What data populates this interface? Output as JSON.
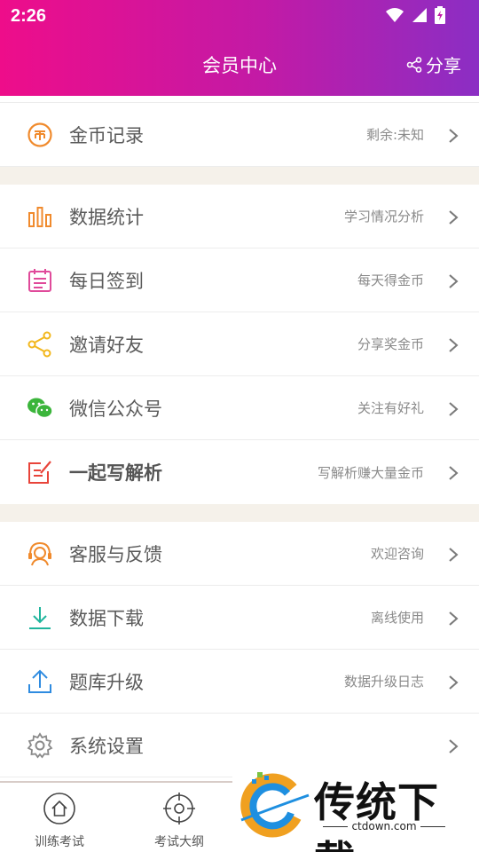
{
  "status_bar": {
    "time": "2:26"
  },
  "header": {
    "title": "会员中心",
    "share_label": "分享"
  },
  "groups": [
    {
      "items": [
        {
          "label": "金币记录",
          "sub": "剩余:未知",
          "icon": "coin-icon",
          "color": "#f08a2c"
        }
      ]
    },
    {
      "items": [
        {
          "label": "数据统计",
          "sub": "学习情况分析",
          "icon": "bar-chart-icon",
          "color": "#f08a2c"
        },
        {
          "label": "每日签到",
          "sub": "每天得金币",
          "icon": "calendar-icon",
          "color": "#e04a9a"
        },
        {
          "label": "邀请好友",
          "sub": "分享奖金币",
          "icon": "share-nodes-icon",
          "color": "#f2b71d"
        },
        {
          "label": "微信公众号",
          "sub": "关注有好礼",
          "icon": "wechat-icon",
          "color": "#3bb53b"
        },
        {
          "label": "一起写解析",
          "sub": "写解析赚大量金币",
          "icon": "edit-note-icon",
          "color": "#e8443a"
        }
      ]
    },
    {
      "items": [
        {
          "label": "客服与反馈",
          "sub": "欢迎咨询",
          "icon": "headset-icon",
          "color": "#f08a2c"
        },
        {
          "label": "数据下载",
          "sub": "离线使用",
          "icon": "download-icon",
          "color": "#1fb59d"
        },
        {
          "label": "题库升级",
          "sub": "数据升级日志",
          "icon": "upload-icon",
          "color": "#2e8be0"
        },
        {
          "label": "系统设置",
          "sub": "",
          "icon": "gear-icon",
          "color": "#8a8a8a"
        }
      ]
    }
  ],
  "tabbar": {
    "tabs": [
      {
        "label": "训练考试",
        "icon": "home-icon"
      },
      {
        "label": "考试大纲",
        "icon": "target-icon"
      }
    ]
  },
  "watermark": {
    "title": "传统下载",
    "url": "ctdown.com"
  }
}
